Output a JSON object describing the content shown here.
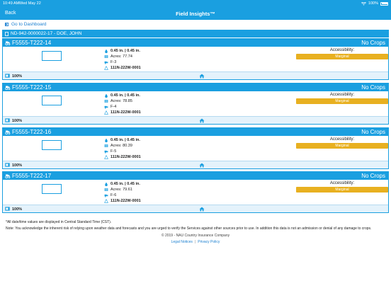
{
  "status": {
    "time": "10:49 AM",
    "date": "Wed May 22",
    "battery": "100%"
  },
  "nav": {
    "back": "Back",
    "title": "Field Insights™"
  },
  "dashboard_link": "Go to Dashboard",
  "owner": "ND-942-0000022-17 - DOE, JOHN",
  "fields": [
    {
      "id": "F5555-T222-14",
      "crop": "No Crops",
      "rain": "0.45 in. | 0.45 in.",
      "acres": "Acres: 77.74",
      "parcel": "F-3",
      "legal": "111N-222W-0001",
      "access_label": "Accessibility:",
      "access_value": "Marginal",
      "percent": "100%"
    },
    {
      "id": "F5555-T222-15",
      "crop": "No Crops",
      "rain": "0.45 in. | 0.45 in.",
      "acres": "Acres: 78.85",
      "parcel": "F-4",
      "legal": "111N-222W-0001",
      "access_label": "Accessibility:",
      "access_value": "Marginal",
      "percent": "100%"
    },
    {
      "id": "F5555-T222-16",
      "crop": "No Crops",
      "rain": "0.45 in. | 0.45 in.",
      "acres": "Acres: 80.39",
      "parcel": "F-5",
      "legal": "111N-222W-0001",
      "access_label": "Accessibility:",
      "access_value": "Marginal",
      "percent": "100%"
    },
    {
      "id": "F5555-T222-17",
      "crop": "No Crops",
      "rain": "0.45 in. | 0.45 in.",
      "acres": "Acres: 79.61",
      "parcel": "F-6",
      "legal": "111N-222W-0001",
      "access_label": "Accessibility:",
      "access_value": "Marginal",
      "percent": "100%"
    }
  ],
  "footer": {
    "note_time": "*All date/time values are displayed in Central Standard Time (CST).",
    "note_disclaimer": "Note: You acknowledge the inherent risk of relying upon weather data and forecasts and you are urged to verify the Services against other sources prior to use. In addition this data is not an admission or denial of any damage to crops.",
    "copyright": "© 2019 - NAU Country Insurance Company",
    "legal_link": "Legal Notices",
    "separator": "|",
    "privacy_link": "Privacy Policy"
  },
  "colors": {
    "brand": "#1a9fe0",
    "accent": "#e8b020",
    "link": "#1a7fd0"
  },
  "icons": [
    "wifi-icon",
    "battery-icon",
    "dashboard-icon",
    "tractor-icon",
    "rain-icon",
    "acres-icon",
    "parcel-icon",
    "legal-icon",
    "square-icon",
    "home-icon"
  ]
}
